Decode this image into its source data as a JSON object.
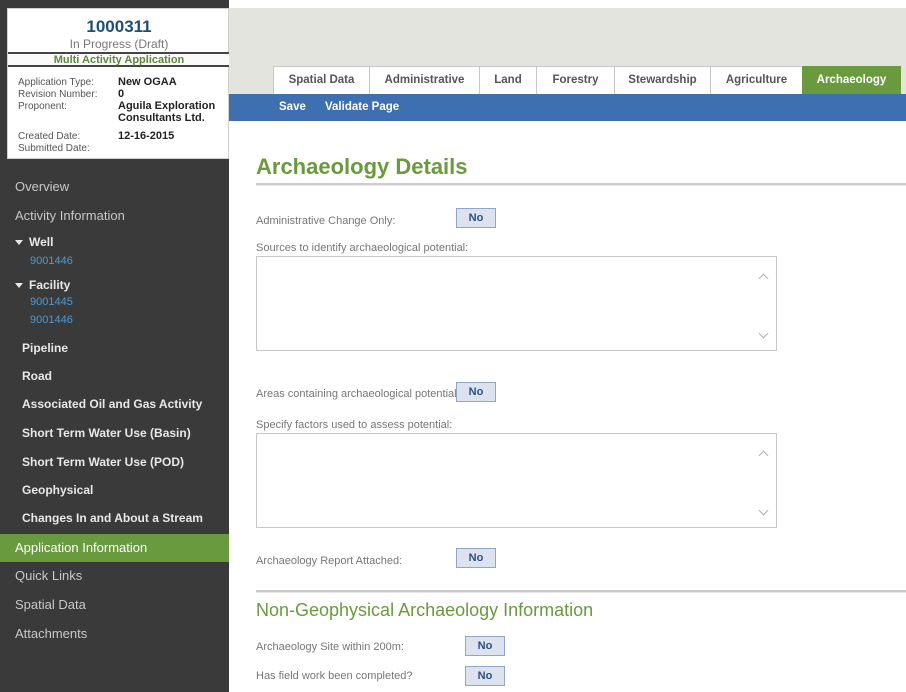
{
  "application": {
    "number": "1000311",
    "status": "In Progress (Draft)",
    "kind": "Multi Activity Application",
    "fields": [
      {
        "label": "Application Type:",
        "value": "New OGAA"
      },
      {
        "label": "Revision Number:",
        "value": "0"
      },
      {
        "label": "Proponent:",
        "value": "Aguila Exploration Consultants Ltd."
      },
      {
        "label": "Created Date:",
        "value": "12-16-2015"
      },
      {
        "label": "Submitted Date:",
        "value": ""
      }
    ]
  },
  "sidebar": {
    "overview": "Overview",
    "activity_information": "Activity Information",
    "well": {
      "label": "Well",
      "items": [
        "9001446"
      ]
    },
    "facility": {
      "label": "Facility",
      "items": [
        "9001445",
        "9001446"
      ]
    },
    "activities": [
      "Pipeline",
      "Road",
      "Associated Oil and Gas Activity",
      "Short Term Water Use (Basin)",
      "Short Term Water Use (POD)",
      "Geophysical",
      "Changes In and About a Stream"
    ],
    "application_information": "Application Information",
    "quick_links": "Quick Links",
    "spatial_data": "Spatial Data",
    "attachments": "Attachments"
  },
  "tabs": [
    "Spatial Data",
    "Administrative",
    "Land",
    "Forestry",
    "Stewardship",
    "Agriculture",
    "Archaeology"
  ],
  "active_tab": "Archaeology",
  "toolbar": {
    "save": "Save",
    "validate": "Validate Page"
  },
  "main": {
    "title": "Archaeology Details",
    "admin_change_label": "Administrative Change Only:",
    "admin_change_value": "No",
    "sources_label": "Sources to identify archaeological potential:",
    "areas_label": "Areas containing archaeological potential:",
    "areas_value": "No",
    "factors_label": "Specify factors used to assess potential:",
    "report_label": "Archaeology Report Attached:",
    "report_value": "No",
    "section_title": "Non-Geophysical Archaeology Information",
    "site_label": "Archaeology Site within 200m:",
    "site_value": "No",
    "fieldwork_label": "Has field work been completed?",
    "fieldwork_value": "No"
  },
  "colors": {
    "accent_green": "#6a9a3e",
    "toolbar_blue": "#3d6fb1",
    "sidebar_dark": "#3a3a3a",
    "link_blue": "#4a9ad8"
  }
}
